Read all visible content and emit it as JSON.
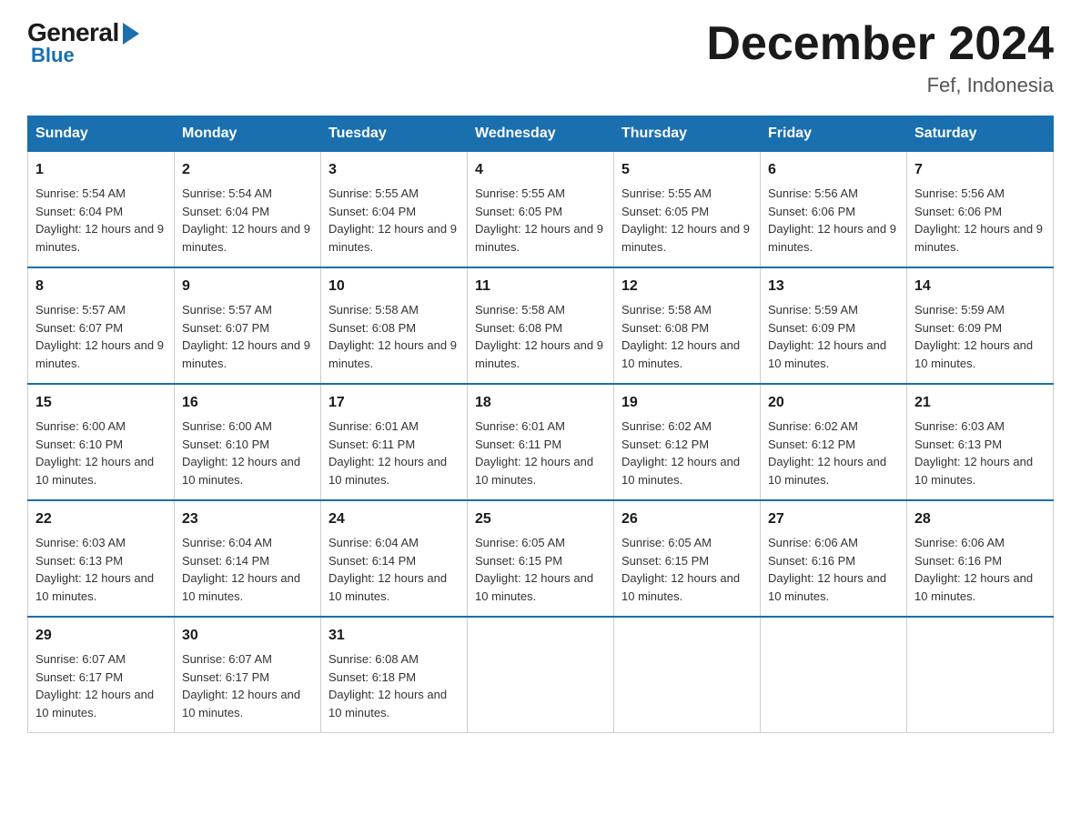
{
  "header": {
    "logo_general": "General",
    "logo_blue": "Blue",
    "title": "December 2024",
    "location": "Fef, Indonesia"
  },
  "days_of_week": [
    "Sunday",
    "Monday",
    "Tuesday",
    "Wednesday",
    "Thursday",
    "Friday",
    "Saturday"
  ],
  "weeks": [
    [
      {
        "day": "1",
        "sunrise": "5:54 AM",
        "sunset": "6:04 PM",
        "daylight": "12 hours and 9 minutes."
      },
      {
        "day": "2",
        "sunrise": "5:54 AM",
        "sunset": "6:04 PM",
        "daylight": "12 hours and 9 minutes."
      },
      {
        "day": "3",
        "sunrise": "5:55 AM",
        "sunset": "6:04 PM",
        "daylight": "12 hours and 9 minutes."
      },
      {
        "day": "4",
        "sunrise": "5:55 AM",
        "sunset": "6:05 PM",
        "daylight": "12 hours and 9 minutes."
      },
      {
        "day": "5",
        "sunrise": "5:55 AM",
        "sunset": "6:05 PM",
        "daylight": "12 hours and 9 minutes."
      },
      {
        "day": "6",
        "sunrise": "5:56 AM",
        "sunset": "6:06 PM",
        "daylight": "12 hours and 9 minutes."
      },
      {
        "day": "7",
        "sunrise": "5:56 AM",
        "sunset": "6:06 PM",
        "daylight": "12 hours and 9 minutes."
      }
    ],
    [
      {
        "day": "8",
        "sunrise": "5:57 AM",
        "sunset": "6:07 PM",
        "daylight": "12 hours and 9 minutes."
      },
      {
        "day": "9",
        "sunrise": "5:57 AM",
        "sunset": "6:07 PM",
        "daylight": "12 hours and 9 minutes."
      },
      {
        "day": "10",
        "sunrise": "5:58 AM",
        "sunset": "6:08 PM",
        "daylight": "12 hours and 9 minutes."
      },
      {
        "day": "11",
        "sunrise": "5:58 AM",
        "sunset": "6:08 PM",
        "daylight": "12 hours and 9 minutes."
      },
      {
        "day": "12",
        "sunrise": "5:58 AM",
        "sunset": "6:08 PM",
        "daylight": "12 hours and 10 minutes."
      },
      {
        "day": "13",
        "sunrise": "5:59 AM",
        "sunset": "6:09 PM",
        "daylight": "12 hours and 10 minutes."
      },
      {
        "day": "14",
        "sunrise": "5:59 AM",
        "sunset": "6:09 PM",
        "daylight": "12 hours and 10 minutes."
      }
    ],
    [
      {
        "day": "15",
        "sunrise": "6:00 AM",
        "sunset": "6:10 PM",
        "daylight": "12 hours and 10 minutes."
      },
      {
        "day": "16",
        "sunrise": "6:00 AM",
        "sunset": "6:10 PM",
        "daylight": "12 hours and 10 minutes."
      },
      {
        "day": "17",
        "sunrise": "6:01 AM",
        "sunset": "6:11 PM",
        "daylight": "12 hours and 10 minutes."
      },
      {
        "day": "18",
        "sunrise": "6:01 AM",
        "sunset": "6:11 PM",
        "daylight": "12 hours and 10 minutes."
      },
      {
        "day": "19",
        "sunrise": "6:02 AM",
        "sunset": "6:12 PM",
        "daylight": "12 hours and 10 minutes."
      },
      {
        "day": "20",
        "sunrise": "6:02 AM",
        "sunset": "6:12 PM",
        "daylight": "12 hours and 10 minutes."
      },
      {
        "day": "21",
        "sunrise": "6:03 AM",
        "sunset": "6:13 PM",
        "daylight": "12 hours and 10 minutes."
      }
    ],
    [
      {
        "day": "22",
        "sunrise": "6:03 AM",
        "sunset": "6:13 PM",
        "daylight": "12 hours and 10 minutes."
      },
      {
        "day": "23",
        "sunrise": "6:04 AM",
        "sunset": "6:14 PM",
        "daylight": "12 hours and 10 minutes."
      },
      {
        "day": "24",
        "sunrise": "6:04 AM",
        "sunset": "6:14 PM",
        "daylight": "12 hours and 10 minutes."
      },
      {
        "day": "25",
        "sunrise": "6:05 AM",
        "sunset": "6:15 PM",
        "daylight": "12 hours and 10 minutes."
      },
      {
        "day": "26",
        "sunrise": "6:05 AM",
        "sunset": "6:15 PM",
        "daylight": "12 hours and 10 minutes."
      },
      {
        "day": "27",
        "sunrise": "6:06 AM",
        "sunset": "6:16 PM",
        "daylight": "12 hours and 10 minutes."
      },
      {
        "day": "28",
        "sunrise": "6:06 AM",
        "sunset": "6:16 PM",
        "daylight": "12 hours and 10 minutes."
      }
    ],
    [
      {
        "day": "29",
        "sunrise": "6:07 AM",
        "sunset": "6:17 PM",
        "daylight": "12 hours and 10 minutes."
      },
      {
        "day": "30",
        "sunrise": "6:07 AM",
        "sunset": "6:17 PM",
        "daylight": "12 hours and 10 minutes."
      },
      {
        "day": "31",
        "sunrise": "6:08 AM",
        "sunset": "6:18 PM",
        "daylight": "12 hours and 10 minutes."
      },
      null,
      null,
      null,
      null
    ]
  ],
  "labels": {
    "sunrise": "Sunrise:",
    "sunset": "Sunset:",
    "daylight": "Daylight:"
  }
}
